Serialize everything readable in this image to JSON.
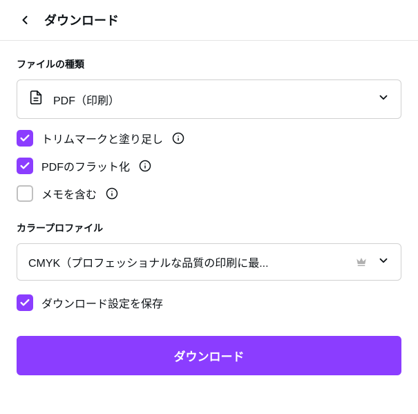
{
  "header": {
    "title": "ダウンロード"
  },
  "file_type": {
    "label": "ファイルの種類",
    "selected": "PDF（印刷）"
  },
  "options": {
    "trim_marks": {
      "label": "トリムマークと塗り足し",
      "checked": true
    },
    "flatten_pdf": {
      "label": "PDFのフラット化",
      "checked": true
    },
    "include_notes": {
      "label": "メモを含む",
      "checked": false
    },
    "save_settings": {
      "label": "ダウンロード設定を保存",
      "checked": true
    }
  },
  "color_profile": {
    "label": "カラープロファイル",
    "selected": "CMYK（プロフェッショナルな品質の印刷に最..."
  },
  "download_button": "ダウンロード"
}
